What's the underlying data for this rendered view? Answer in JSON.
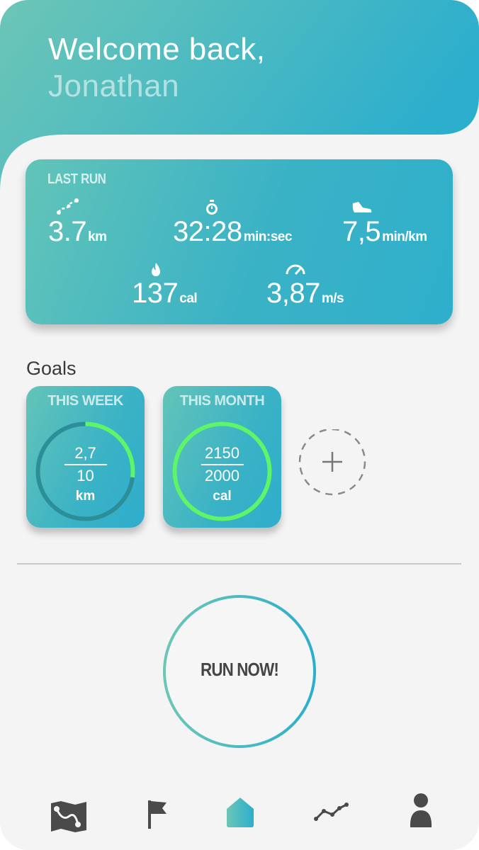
{
  "greeting": {
    "line1": "Welcome back,",
    "line2": "Jonathan"
  },
  "last_run": {
    "title": "LAST RUN",
    "stats": [
      {
        "icon": "route-icon",
        "value": "3.7",
        "unit": "km"
      },
      {
        "icon": "stopwatch-icon",
        "value": "32:28",
        "unit": "min:sec"
      },
      {
        "icon": "shoe-icon",
        "value": "7,5",
        "unit": "min/km"
      },
      {
        "icon": "flame-icon",
        "value": "137",
        "unit": "cal"
      },
      {
        "icon": "speedometer-icon",
        "value": "3,87",
        "unit": "m/s"
      }
    ]
  },
  "goals": {
    "title": "Goals",
    "items": [
      {
        "title": "THIS WEEK",
        "current": "2,7",
        "target": "10",
        "unit": "km",
        "progress": 0.27
      },
      {
        "title": "THIS MONTH",
        "current": "2150",
        "target": "2000",
        "unit": "cal",
        "progress": 1.0
      }
    ],
    "add_icon": "plus-icon"
  },
  "run_button": {
    "label": "RUN NOW!"
  },
  "nav": [
    "map-icon",
    "flag-icon",
    "home-icon",
    "stats-line-icon",
    "profile-icon"
  ],
  "colors": {
    "teal_light": "#6cc6b6",
    "teal_dark": "#2caecd",
    "progress_green": "#5ef56a",
    "text_dark": "#3a3a3a"
  }
}
